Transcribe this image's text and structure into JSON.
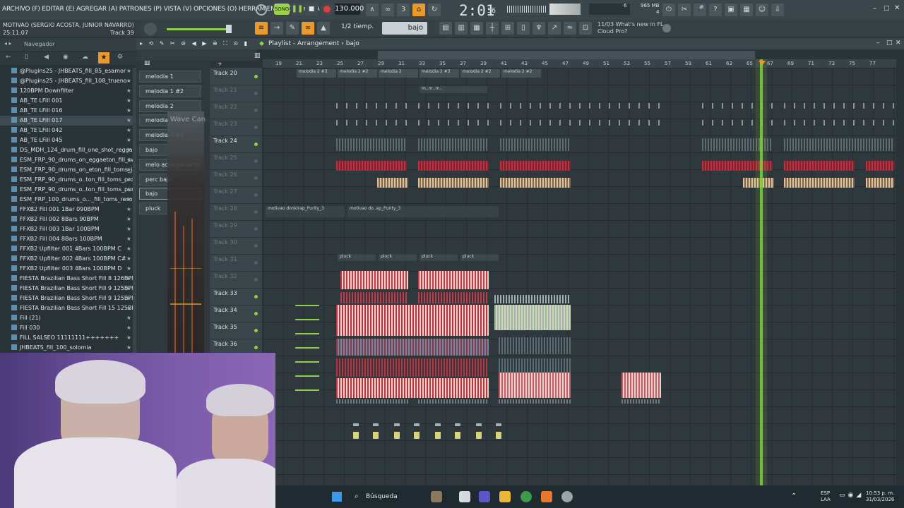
{
  "menubar": {
    "items": "ARCHIVO (F) EDITAR (E) AGREGAR (A) PATRONES (P) VISTA (V) OPCIONES (O) HERRAMIENTAS (T) AYUDA",
    "song_button": "SONG",
    "tempo": "130.000",
    "clock_main": "2:01",
    "clock_sub": "56",
    "memory_line1": "965 MB",
    "memory_line2": "4",
    "memory_cpu": "6"
  },
  "songinfo": {
    "title": "MOTIVAO (SERGIO ACOSTA, JUNIOR NAVARRO)",
    "time": "25:11:07",
    "track": "Track 39"
  },
  "toolbar2": {
    "snap_label": "1/2 tiemp.",
    "snap_value": "bajo",
    "news_line1": "11/03  What's new in FL",
    "news_line2": "Cloud Pro?"
  },
  "browser": {
    "title": "Navegador",
    "items": [
      {
        "label": "@Plugins25 - JHBEATS_fill_85_esamor"
      },
      {
        "label": "@Plugins25 - JHBEATS_fill_108_trueno"
      },
      {
        "label": "120BPM Downfilter"
      },
      {
        "label": "AB_TE LFill 001"
      },
      {
        "label": "AB_TE LFill 016"
      },
      {
        "label": "AB_TE LFill 017"
      },
      {
        "label": "AB_TE LFill 042"
      },
      {
        "label": "AB_TE LFill 045"
      },
      {
        "label": "DS_MDH_124_drum_fill_one_shot_reggae"
      },
      {
        "label": "ESM_FRP_90_drums_on_eggaeton_fill_swing"
      },
      {
        "label": "ESM_FRP_90_drums_on_eton_fill_toms_jack"
      },
      {
        "label": "ESM_FRP_90_drums_o..ton_fill_toms_proud"
      },
      {
        "label": "ESM_FRP_90_drums_o..ton_fill_toms_punch"
      },
      {
        "label": "ESM_FRP_100_drums_o..._fill_toms_resonate"
      },
      {
        "label": "FFXB2 Fill 001 1Bar 090BPM"
      },
      {
        "label": "FFXB2 Fill 002 8Bars 90BPM"
      },
      {
        "label": "FFXB2 Fill 003 1Bar 100BPM"
      },
      {
        "label": "FFXB2 Fill 004 8Bars 100BPM"
      },
      {
        "label": "FFXB2 Upfilter 001 4Bars 100BPM C"
      },
      {
        "label": "FFXB2 Upfilter 002 4Bars 100BPM C#"
      },
      {
        "label": "FFXB2 Upfilter 003 4Bars 100BPM D"
      },
      {
        "label": "FIESTA Brazilian Bass Short Fill 8 126BPM"
      },
      {
        "label": "FIESTA Brazilian Bass Short Fill 9 125BPM"
      },
      {
        "label": "FIESTA Brazilian Bass Short Fill 9 125BPM"
      },
      {
        "label": "FIESTA Brazilian Bass Short Fill 15 125BPM"
      },
      {
        "label": "Fill (21)"
      },
      {
        "label": "Fill 030"
      },
      {
        "label": "FILL SALSEO 11111111+++++++"
      },
      {
        "label": "JHBEATS_fill_100_solomia"
      }
    ]
  },
  "channels": [
    {
      "label": "melodia 1"
    },
    {
      "label": "melodia 1 #2"
    },
    {
      "label": "melodia 2"
    },
    {
      "label": "melodia"
    },
    {
      "label": "melodia 2 #3"
    },
    {
      "label": "bajo"
    },
    {
      "label": "melo acompañante"
    },
    {
      "label": "perc bajo"
    },
    {
      "label": "bajo"
    },
    {
      "label": "pluck"
    }
  ],
  "wave_label": "Wave Can",
  "playlist": {
    "title": "Playlist - Arrangement",
    "pattern": "bajo",
    "ruler": [
      "19",
      "21",
      "23",
      "25",
      "27",
      "29",
      "31",
      "33",
      "35",
      "37",
      "39",
      "41",
      "43",
      "45",
      "47",
      "49",
      "51",
      "53",
      "55",
      "57",
      "59",
      "61",
      "63",
      "65",
      "67",
      "69",
      "71",
      "73",
      "75",
      "77"
    ],
    "tracks": [
      {
        "label": "Track 20",
        "dim": false
      },
      {
        "label": "Track 21",
        "dim": true
      },
      {
        "label": "Track 22",
        "dim": true
      },
      {
        "label": "Track 23",
        "dim": true
      },
      {
        "label": "Track 24",
        "dim": false
      },
      {
        "label": "Track 25",
        "dim": true
      },
      {
        "label": "Track 26",
        "dim": true
      },
      {
        "label": "Track 27",
        "dim": true
      },
      {
        "label": "Track 28",
        "dim": true
      },
      {
        "label": "Track 29",
        "dim": true
      },
      {
        "label": "Track 30",
        "dim": true
      },
      {
        "label": "Track 31",
        "dim": true
      },
      {
        "label": "Track 32",
        "dim": true
      },
      {
        "label": "Track 33",
        "dim": false
      },
      {
        "label": "Track 34",
        "dim": false
      },
      {
        "label": "Track 35",
        "dim": false
      },
      {
        "label": "Track 36",
        "dim": false
      }
    ],
    "clip_labels": {
      "melodia2_3": "melodia 2 #3",
      "melodia2_2": "melodia 2 #2",
      "melodia2": "melodia 2",
      "mtm": "m..m..m..",
      "audio1": "motivao donkirap_Purity_3",
      "audio2": "motivao do..ap_Purity_3",
      "pluck": "pluck"
    }
  },
  "taskbar": {
    "search": "Búsqueda",
    "lang_line1": "ESP",
    "lang_line2": "LAA",
    "time": "10:53 p. m.",
    "date": "31/03/2026"
  },
  "colors": {
    "accent": "#e99a2b",
    "playhead": "#7fd43a",
    "clip_red": "#b8323f",
    "clip_beige": "#d8b88e"
  }
}
